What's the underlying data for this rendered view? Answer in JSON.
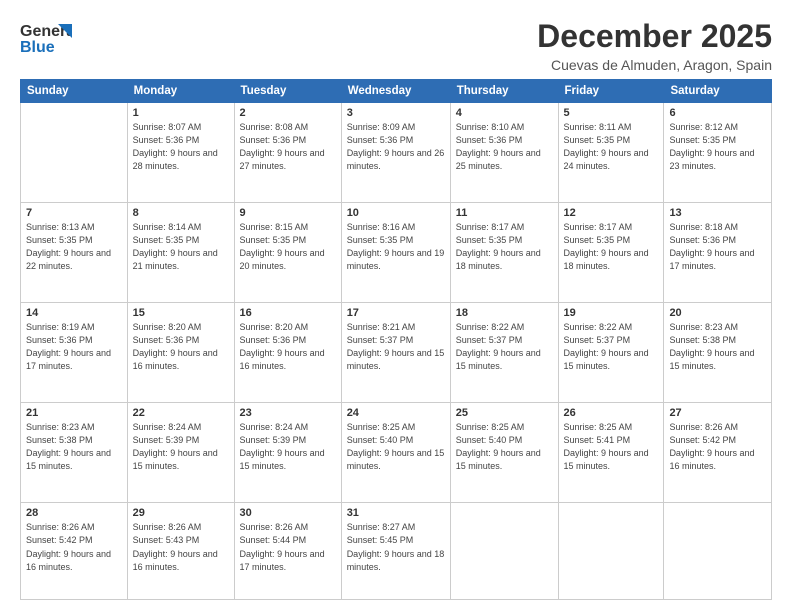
{
  "header": {
    "logo_general": "General",
    "logo_blue": "Blue",
    "month_title": "December 2025",
    "location": "Cuevas de Almuden, Aragon, Spain"
  },
  "weekdays": [
    "Sunday",
    "Monday",
    "Tuesday",
    "Wednesday",
    "Thursday",
    "Friday",
    "Saturday"
  ],
  "weeks": [
    [
      {
        "day": "",
        "sunrise": "",
        "sunset": "",
        "daylight": ""
      },
      {
        "day": "1",
        "sunrise": "Sunrise: 8:07 AM",
        "sunset": "Sunset: 5:36 PM",
        "daylight": "Daylight: 9 hours and 28 minutes."
      },
      {
        "day": "2",
        "sunrise": "Sunrise: 8:08 AM",
        "sunset": "Sunset: 5:36 PM",
        "daylight": "Daylight: 9 hours and 27 minutes."
      },
      {
        "day": "3",
        "sunrise": "Sunrise: 8:09 AM",
        "sunset": "Sunset: 5:36 PM",
        "daylight": "Daylight: 9 hours and 26 minutes."
      },
      {
        "day": "4",
        "sunrise": "Sunrise: 8:10 AM",
        "sunset": "Sunset: 5:36 PM",
        "daylight": "Daylight: 9 hours and 25 minutes."
      },
      {
        "day": "5",
        "sunrise": "Sunrise: 8:11 AM",
        "sunset": "Sunset: 5:35 PM",
        "daylight": "Daylight: 9 hours and 24 minutes."
      },
      {
        "day": "6",
        "sunrise": "Sunrise: 8:12 AM",
        "sunset": "Sunset: 5:35 PM",
        "daylight": "Daylight: 9 hours and 23 minutes."
      }
    ],
    [
      {
        "day": "7",
        "sunrise": "Sunrise: 8:13 AM",
        "sunset": "Sunset: 5:35 PM",
        "daylight": "Daylight: 9 hours and 22 minutes."
      },
      {
        "day": "8",
        "sunrise": "Sunrise: 8:14 AM",
        "sunset": "Sunset: 5:35 PM",
        "daylight": "Daylight: 9 hours and 21 minutes."
      },
      {
        "day": "9",
        "sunrise": "Sunrise: 8:15 AM",
        "sunset": "Sunset: 5:35 PM",
        "daylight": "Daylight: 9 hours and 20 minutes."
      },
      {
        "day": "10",
        "sunrise": "Sunrise: 8:16 AM",
        "sunset": "Sunset: 5:35 PM",
        "daylight": "Daylight: 9 hours and 19 minutes."
      },
      {
        "day": "11",
        "sunrise": "Sunrise: 8:17 AM",
        "sunset": "Sunset: 5:35 PM",
        "daylight": "Daylight: 9 hours and 18 minutes."
      },
      {
        "day": "12",
        "sunrise": "Sunrise: 8:17 AM",
        "sunset": "Sunset: 5:35 PM",
        "daylight": "Daylight: 9 hours and 18 minutes."
      },
      {
        "day": "13",
        "sunrise": "Sunrise: 8:18 AM",
        "sunset": "Sunset: 5:36 PM",
        "daylight": "Daylight: 9 hours and 17 minutes."
      }
    ],
    [
      {
        "day": "14",
        "sunrise": "Sunrise: 8:19 AM",
        "sunset": "Sunset: 5:36 PM",
        "daylight": "Daylight: 9 hours and 17 minutes."
      },
      {
        "day": "15",
        "sunrise": "Sunrise: 8:20 AM",
        "sunset": "Sunset: 5:36 PM",
        "daylight": "Daylight: 9 hours and 16 minutes."
      },
      {
        "day": "16",
        "sunrise": "Sunrise: 8:20 AM",
        "sunset": "Sunset: 5:36 PM",
        "daylight": "Daylight: 9 hours and 16 minutes."
      },
      {
        "day": "17",
        "sunrise": "Sunrise: 8:21 AM",
        "sunset": "Sunset: 5:37 PM",
        "daylight": "Daylight: 9 hours and 15 minutes."
      },
      {
        "day": "18",
        "sunrise": "Sunrise: 8:22 AM",
        "sunset": "Sunset: 5:37 PM",
        "daylight": "Daylight: 9 hours and 15 minutes."
      },
      {
        "day": "19",
        "sunrise": "Sunrise: 8:22 AM",
        "sunset": "Sunset: 5:37 PM",
        "daylight": "Daylight: 9 hours and 15 minutes."
      },
      {
        "day": "20",
        "sunrise": "Sunrise: 8:23 AM",
        "sunset": "Sunset: 5:38 PM",
        "daylight": "Daylight: 9 hours and 15 minutes."
      }
    ],
    [
      {
        "day": "21",
        "sunrise": "Sunrise: 8:23 AM",
        "sunset": "Sunset: 5:38 PM",
        "daylight": "Daylight: 9 hours and 15 minutes."
      },
      {
        "day": "22",
        "sunrise": "Sunrise: 8:24 AM",
        "sunset": "Sunset: 5:39 PM",
        "daylight": "Daylight: 9 hours and 15 minutes."
      },
      {
        "day": "23",
        "sunrise": "Sunrise: 8:24 AM",
        "sunset": "Sunset: 5:39 PM",
        "daylight": "Daylight: 9 hours and 15 minutes."
      },
      {
        "day": "24",
        "sunrise": "Sunrise: 8:25 AM",
        "sunset": "Sunset: 5:40 PM",
        "daylight": "Daylight: 9 hours and 15 minutes."
      },
      {
        "day": "25",
        "sunrise": "Sunrise: 8:25 AM",
        "sunset": "Sunset: 5:40 PM",
        "daylight": "Daylight: 9 hours and 15 minutes."
      },
      {
        "day": "26",
        "sunrise": "Sunrise: 8:25 AM",
        "sunset": "Sunset: 5:41 PM",
        "daylight": "Daylight: 9 hours and 15 minutes."
      },
      {
        "day": "27",
        "sunrise": "Sunrise: 8:26 AM",
        "sunset": "Sunset: 5:42 PM",
        "daylight": "Daylight: 9 hours and 16 minutes."
      }
    ],
    [
      {
        "day": "28",
        "sunrise": "Sunrise: 8:26 AM",
        "sunset": "Sunset: 5:42 PM",
        "daylight": "Daylight: 9 hours and 16 minutes."
      },
      {
        "day": "29",
        "sunrise": "Sunrise: 8:26 AM",
        "sunset": "Sunset: 5:43 PM",
        "daylight": "Daylight: 9 hours and 16 minutes."
      },
      {
        "day": "30",
        "sunrise": "Sunrise: 8:26 AM",
        "sunset": "Sunset: 5:44 PM",
        "daylight": "Daylight: 9 hours and 17 minutes."
      },
      {
        "day": "31",
        "sunrise": "Sunrise: 8:27 AM",
        "sunset": "Sunset: 5:45 PM",
        "daylight": "Daylight: 9 hours and 18 minutes."
      },
      {
        "day": "",
        "sunrise": "",
        "sunset": "",
        "daylight": ""
      },
      {
        "day": "",
        "sunrise": "",
        "sunset": "",
        "daylight": ""
      },
      {
        "day": "",
        "sunrise": "",
        "sunset": "",
        "daylight": ""
      }
    ]
  ]
}
